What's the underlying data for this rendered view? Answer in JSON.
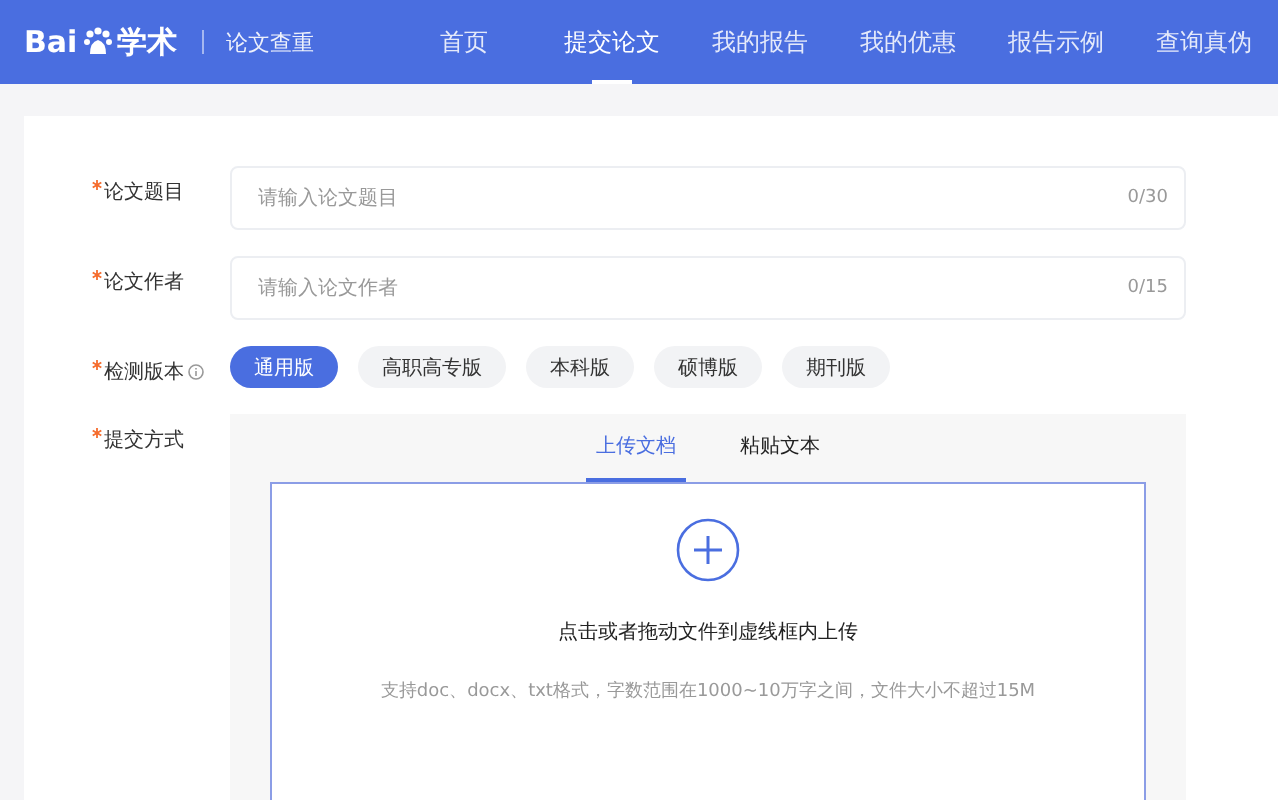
{
  "header": {
    "logo_left": "Bai",
    "logo_right": "学术",
    "product": "论文查重",
    "nav": [
      {
        "label": "首页",
        "selected": false
      },
      {
        "label": "提交论文",
        "selected": true
      },
      {
        "label": "我的报告",
        "selected": false
      },
      {
        "label": "我的优惠",
        "selected": false
      },
      {
        "label": "报告示例",
        "selected": false
      },
      {
        "label": "查询真伪",
        "selected": false
      }
    ]
  },
  "form": {
    "title_field": {
      "required": true,
      "label": "论文题目",
      "placeholder": "请输入论文题目",
      "counter": "0/30"
    },
    "author_field": {
      "required": true,
      "label": "论文作者",
      "placeholder": "请输入论文作者",
      "counter": "0/15"
    },
    "version": {
      "required": true,
      "label": "检测版本",
      "options": [
        {
          "label": "通用版",
          "selected": true
        },
        {
          "label": "高职高专版",
          "selected": false
        },
        {
          "label": "本科版",
          "selected": false
        },
        {
          "label": "硕博版",
          "selected": false
        },
        {
          "label": "期刊版",
          "selected": false
        }
      ]
    },
    "submit": {
      "required": true,
      "label": "提交方式",
      "tabs": [
        {
          "label": "上传文档",
          "selected": true
        },
        {
          "label": "粘贴文本",
          "selected": false
        }
      ],
      "upload": {
        "instruction": "点击或者拖动文件到虚线框内上传",
        "hint": "支持doc、docx、txt格式，字数范围在1000~10万字之间，文件大小不超过15M"
      }
    }
  }
}
